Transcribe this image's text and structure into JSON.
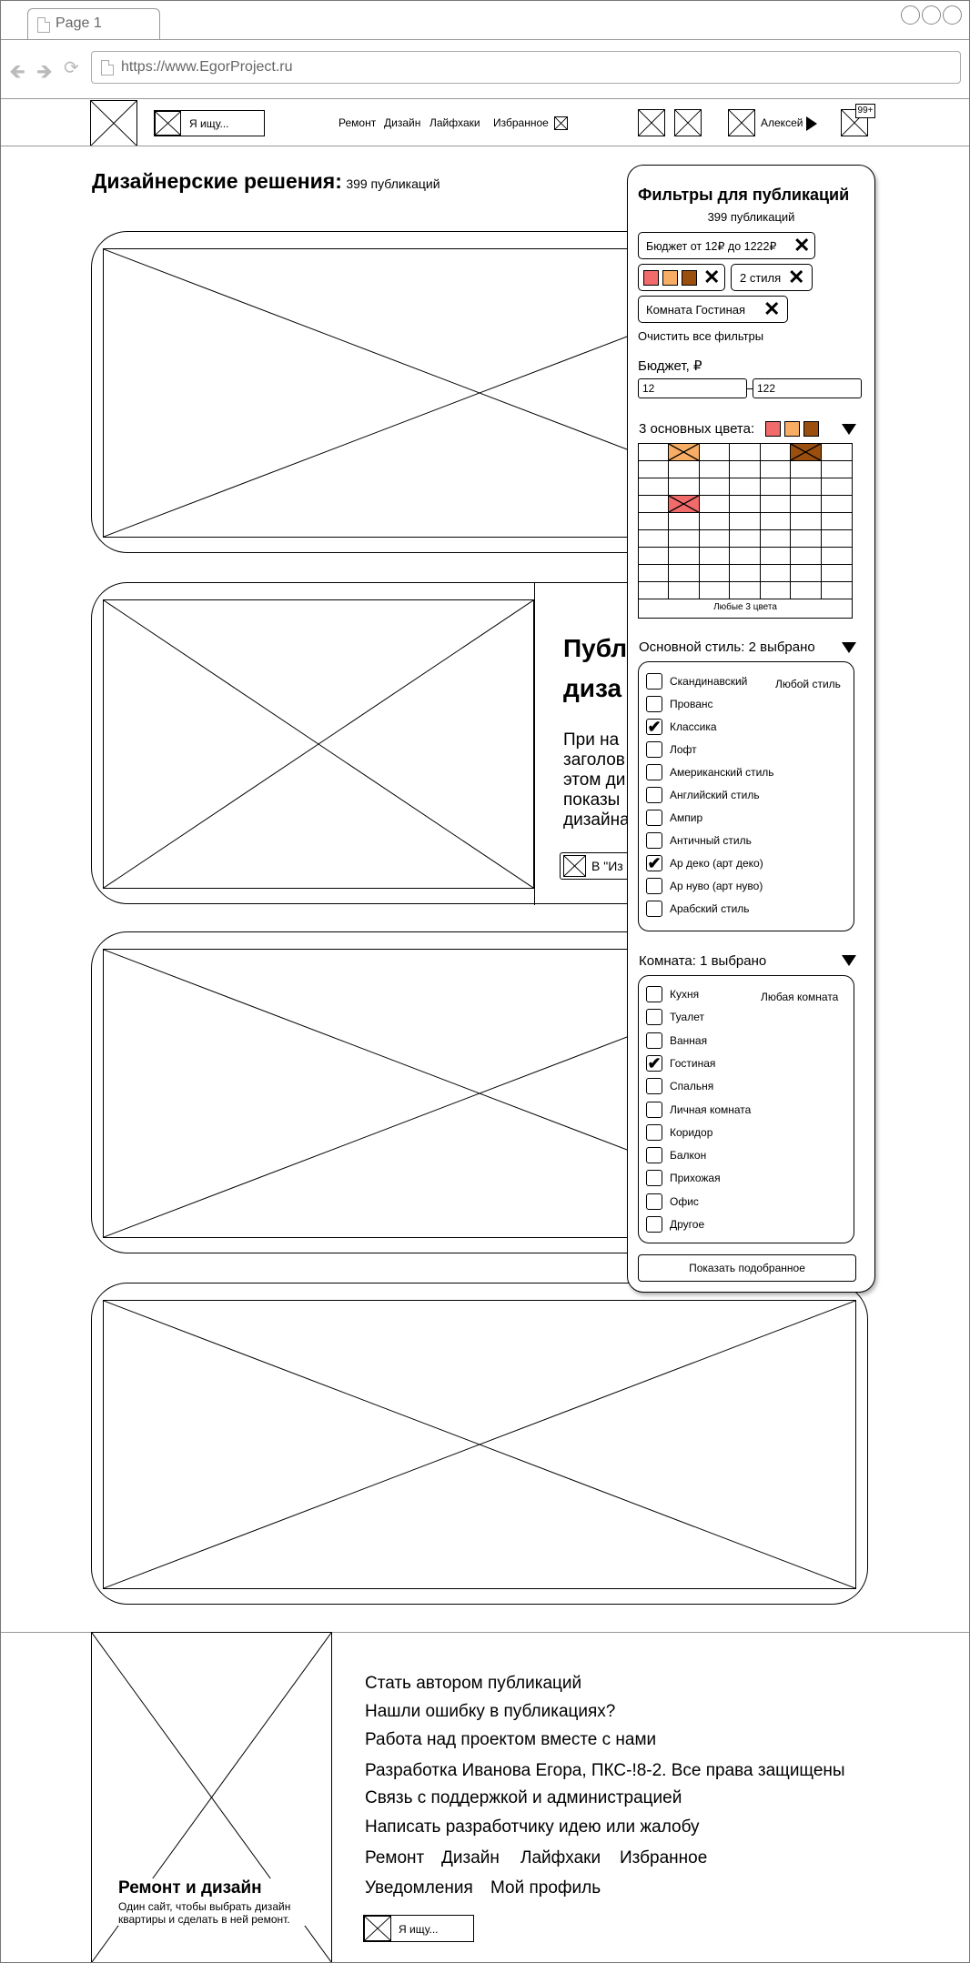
{
  "browser": {
    "tab_title": "Page 1",
    "url": "https://www.EgorProject.ru"
  },
  "header": {
    "search_placeholder": "Я ищу...",
    "nav": [
      "Ремонт",
      "Дизайн",
      "Лайфхаки",
      "Избранное"
    ],
    "user_name": "Алексей",
    "notifications_badge": "99+"
  },
  "main": {
    "title": "Дизайнерские решения:",
    "count": "399 публикаций",
    "card2": {
      "heading_1": "Публ",
      "heading_2": "диза",
      "text_lines": [
        "При на",
        "заголов",
        "этом ди",
        "показы",
        "дизайна"
      ],
      "button_label": "В \"Из"
    }
  },
  "filters": {
    "title": "Фильтры для публикаций",
    "count": "399 публикаций",
    "chip_budget": "Бюджет от 12₽ до 1222₽",
    "chip_styles": "2 стиля",
    "chip_room": "Комната Гостиная",
    "clear_all": "Очистить все фильтры",
    "budget_label": "Бюджет, ₽",
    "budget_from": "12",
    "budget_to": "122",
    "colors_label": "3 основных цвета:",
    "selected_colors": [
      "#f26b6b",
      "#f7ad64",
      "#9b4f0e"
    ],
    "any_colors": "Любые 3 цвета",
    "style_label": "Основной стиль: 2 выбрано",
    "any_style": "Любой стиль",
    "styles": [
      {
        "label": "Скандинавский",
        "checked": false
      },
      {
        "label": "Прованс",
        "checked": false
      },
      {
        "label": "Классика",
        "checked": true
      },
      {
        "label": "Лофт",
        "checked": false
      },
      {
        "label": "Американский стиль",
        "checked": false
      },
      {
        "label": "Английский стиль",
        "checked": false
      },
      {
        "label": "Ампир",
        "checked": false
      },
      {
        "label": "Античный стиль",
        "checked": false
      },
      {
        "label": "Ар деко (арт деко)",
        "checked": true
      },
      {
        "label": "Ар нуво (арт нуво)",
        "checked": false
      },
      {
        "label": "Арабский стиль",
        "checked": false
      }
    ],
    "room_label": "Комната: 1 выбрано",
    "any_room": "Любая комната",
    "rooms": [
      {
        "label": "Кухня",
        "checked": false
      },
      {
        "label": "Туалет",
        "checked": false
      },
      {
        "label": "Ванная",
        "checked": false
      },
      {
        "label": "Гостиная",
        "checked": true
      },
      {
        "label": "Спальня",
        "checked": false
      },
      {
        "label": "Личная комната",
        "checked": false
      },
      {
        "label": "Коридор",
        "checked": false
      },
      {
        "label": "Балкон",
        "checked": false
      },
      {
        "label": "Прихожая",
        "checked": false
      },
      {
        "label": "Офис",
        "checked": false
      },
      {
        "label": "Другое",
        "checked": false
      }
    ],
    "show_button": "Показать подобранное"
  },
  "footer": {
    "brand_title": "Ремонт и дизайн",
    "brand_desc_1": "Один сайт, чтобы выбрать дизайн",
    "brand_desc_2": "квартиры и сделать в ней ремонт.",
    "links": [
      "Стать автором публикаций",
      "Нашли ошибку в публикациях?",
      "Работа над проектом вместе с нами",
      "Разработка Иванова Егора, ПКС-!8-2. Все права защищены",
      "Связь с поддержкой и администрацией",
      "Написать разработчику идею или жалобу"
    ],
    "nav": [
      "Ремонт",
      "Дизайн",
      "Лайфхаки",
      "Избранное"
    ],
    "nav2": [
      "Уведомления",
      "Мой профиль"
    ],
    "search_placeholder": "Я ищу..."
  }
}
